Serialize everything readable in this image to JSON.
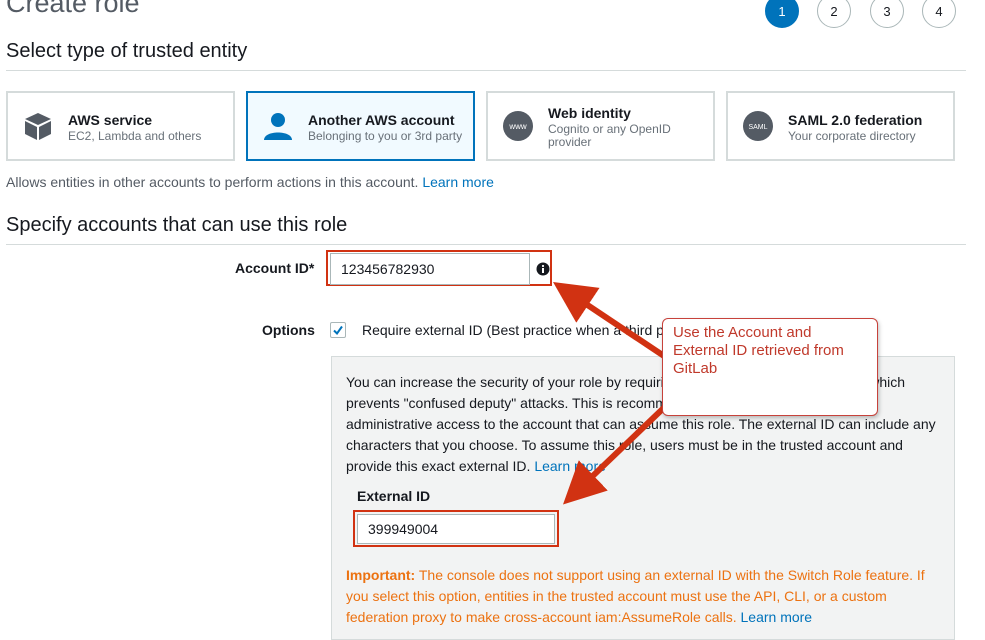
{
  "header": {
    "title": "Create role",
    "steps": [
      "1",
      "2",
      "3",
      "4"
    ],
    "active_step": "1"
  },
  "trusted_entity": {
    "section_title": "Select type of trusted entity",
    "cards": [
      {
        "title": "AWS service",
        "subtitle": "EC2, Lambda and others",
        "icon": "cube-icon",
        "selected": false
      },
      {
        "title": "Another AWS account",
        "subtitle": "Belonging to you or 3rd party",
        "icon": "user-icon",
        "selected": true
      },
      {
        "title": "Web identity",
        "subtitle": "Cognito or any OpenID provider",
        "icon": "www-globe-icon",
        "selected": false
      },
      {
        "title": "SAML 2.0 federation",
        "subtitle": "Your corporate directory",
        "icon": "saml-icon",
        "selected": false
      }
    ],
    "description": "Allows entities in other accounts to perform actions in this account.",
    "learn_more": "Learn more"
  },
  "accounts": {
    "section_title": "Specify accounts that can use this role",
    "account_id_label": "Account ID*",
    "account_id_value": "123456782930",
    "options_label": "Options",
    "require_external_id_label": "Require external ID (Best practice when a third party will assume this role)",
    "require_external_id_checked": true,
    "panel_text": "You can increase the security of your role by requiring an optional external identifier, which prevents \"confused deputy\" attacks. This is recommended if you do not own or have administrative access to the account that can assume this role. The external ID can include any characters that you choose. To assume this role, users must be in the trusted account and provide this exact external ID.",
    "panel_learn_more": "Learn more",
    "external_id_label": "External ID",
    "external_id_value": "399949004",
    "important_label": "Important:",
    "important_text": "The console does not support using an external ID with the Switch Role feature. If you select this option, entities in the trusted account must use the API, CLI, or a custom federation proxy to make cross-account iam:AssumeRole calls.",
    "important_learn_more": "Learn more"
  },
  "annotation": {
    "callout_text": "Use the Account and External ID retrieved from GitLab",
    "color": "#d13212"
  },
  "colors": {
    "primary": "#0073bb",
    "warning": "#ec7211",
    "highlight_red": "#d13212"
  }
}
